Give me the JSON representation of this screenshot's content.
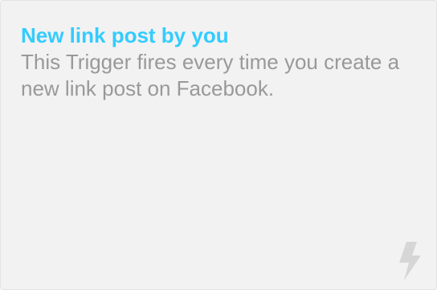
{
  "card": {
    "title": "New link post by you",
    "description": "This Trigger fires every time you create a new link post on Facebook.",
    "icon": "lightning-bolt-icon"
  },
  "colors": {
    "title": "#33ccff",
    "description": "#999999",
    "background": "#f2f2f2",
    "icon": "#d6d6d6"
  }
}
